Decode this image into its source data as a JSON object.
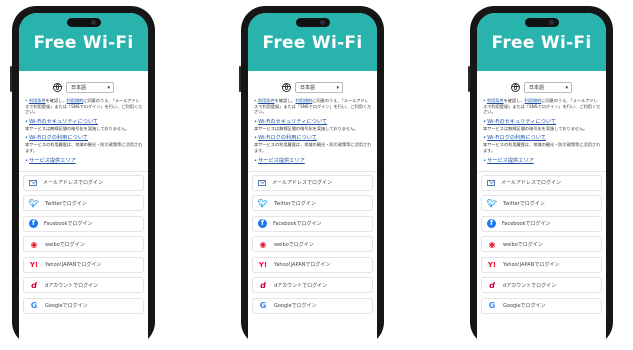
{
  "portal": {
    "title": "Free Wi-Fi",
    "language": "日本語",
    "intro": {
      "terms_link": "利用条件",
      "mid1": "を確認し、",
      "tos_link": "利用規約",
      "rest": "に同意のうえ、「メールアドレスで利用登録」または「SNSでログイン」を行い、ご利用ください。"
    },
    "notes": [
      {
        "title": "Wi-Fiのセキュリティについて",
        "body": "本サービスは無線区間の暗号化を実施しておりません。"
      },
      {
        "title": "Wi-Fiログの利用について",
        "body": "本サービスの利用履歴は、地域の観光・防災政策等に活用されます。"
      },
      {
        "title": "サービス提供エリア",
        "body": ""
      }
    ],
    "logins": [
      {
        "icon": "mail-icon",
        "label": "メールアドレスでログイン"
      },
      {
        "icon": "twitter-icon",
        "label": "Twitterでログイン"
      },
      {
        "icon": "facebook-icon",
        "label": "Facebookでログイン"
      },
      {
        "icon": "weibo-icon",
        "label": "weiboでログイン"
      },
      {
        "icon": "yahoo-icon",
        "label": "Yahoo!JAPANでログイン"
      },
      {
        "icon": "d-account-icon",
        "label": "dアカウントでログイン"
      },
      {
        "icon": "google-icon",
        "label": "Googleでログイン"
      }
    ],
    "colors": {
      "header": "#28b3ad",
      "link": "#1a4fa3"
    }
  }
}
